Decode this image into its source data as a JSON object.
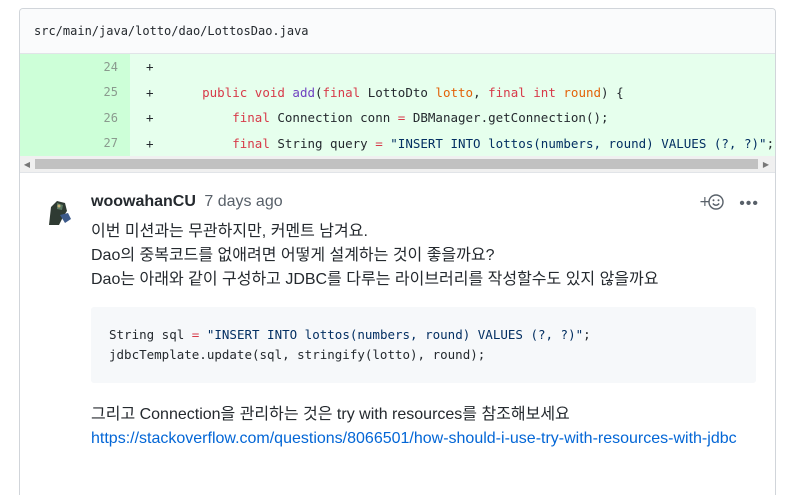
{
  "file": {
    "path": "src/main/java/lotto/dao/LottosDao.java"
  },
  "diff_lines": [
    {
      "num": "24",
      "sign": "+",
      "indent": "",
      "tokens": []
    },
    {
      "num": "25",
      "sign": "+",
      "indent": "    ",
      "tokens": [
        {
          "t": "public void ",
          "c": "kw"
        },
        {
          "t": "add",
          "c": "fn"
        },
        {
          "t": "(",
          "c": ""
        },
        {
          "t": "final ",
          "c": "kw"
        },
        {
          "t": "LottoDto ",
          "c": ""
        },
        {
          "t": "lotto",
          "c": "var"
        },
        {
          "t": ", ",
          "c": ""
        },
        {
          "t": "final int ",
          "c": "kw"
        },
        {
          "t": "round",
          "c": "var"
        },
        {
          "t": ") {",
          "c": ""
        }
      ]
    },
    {
      "num": "26",
      "sign": "+",
      "indent": "        ",
      "tokens": [
        {
          "t": "final ",
          "c": "kw"
        },
        {
          "t": "Connection conn ",
          "c": ""
        },
        {
          "t": "=",
          "c": "kw"
        },
        {
          "t": " DBManager.getConnection();",
          "c": ""
        }
      ]
    },
    {
      "num": "27",
      "sign": "+",
      "indent": "        ",
      "tokens": [
        {
          "t": "final ",
          "c": "kw"
        },
        {
          "t": "String query ",
          "c": ""
        },
        {
          "t": "=",
          "c": "kw"
        },
        {
          "t": " \"INSERT INTO lottos(numbers, round) VALUES (?, ?)\"",
          "c": "str"
        },
        {
          "t": ";",
          "c": ""
        }
      ]
    }
  ],
  "comment": {
    "author": "woowahanCU",
    "time": "7 days ago",
    "lines": [
      "이번 미션과는 무관하지만, 커멘트 남겨요.",
      "Dao의 중복코드를 없애려면 어떻게 설계하는 것이 좋을까요?",
      "Dao는 아래와 같이 구성하고 JDBC를 다루는 라이브러리를 작성할수도 있지 않을까요"
    ],
    "code": [
      [
        {
          "t": "String sql ",
          "c": ""
        },
        {
          "t": "=",
          "c": "kw"
        },
        {
          "t": " \"INSERT INTO lottos(numbers, round) VALUES (?, ?)\"",
          "c": "str"
        },
        {
          "t": ";",
          "c": ""
        }
      ],
      [
        {
          "t": "jdbcTemplate.update(sql, stringify(lotto), round);",
          "c": ""
        }
      ]
    ],
    "after_text": "그리고 Connection을 관리하는 것은 try with resources를 참조해보세요",
    "link": "https://stackoverflow.com/questions/8066501/how-should-i-use-try-with-resources-with-jdbc"
  },
  "icons": {
    "emoji": "smiley-add-icon",
    "more": "kebab-horizontal-icon"
  }
}
